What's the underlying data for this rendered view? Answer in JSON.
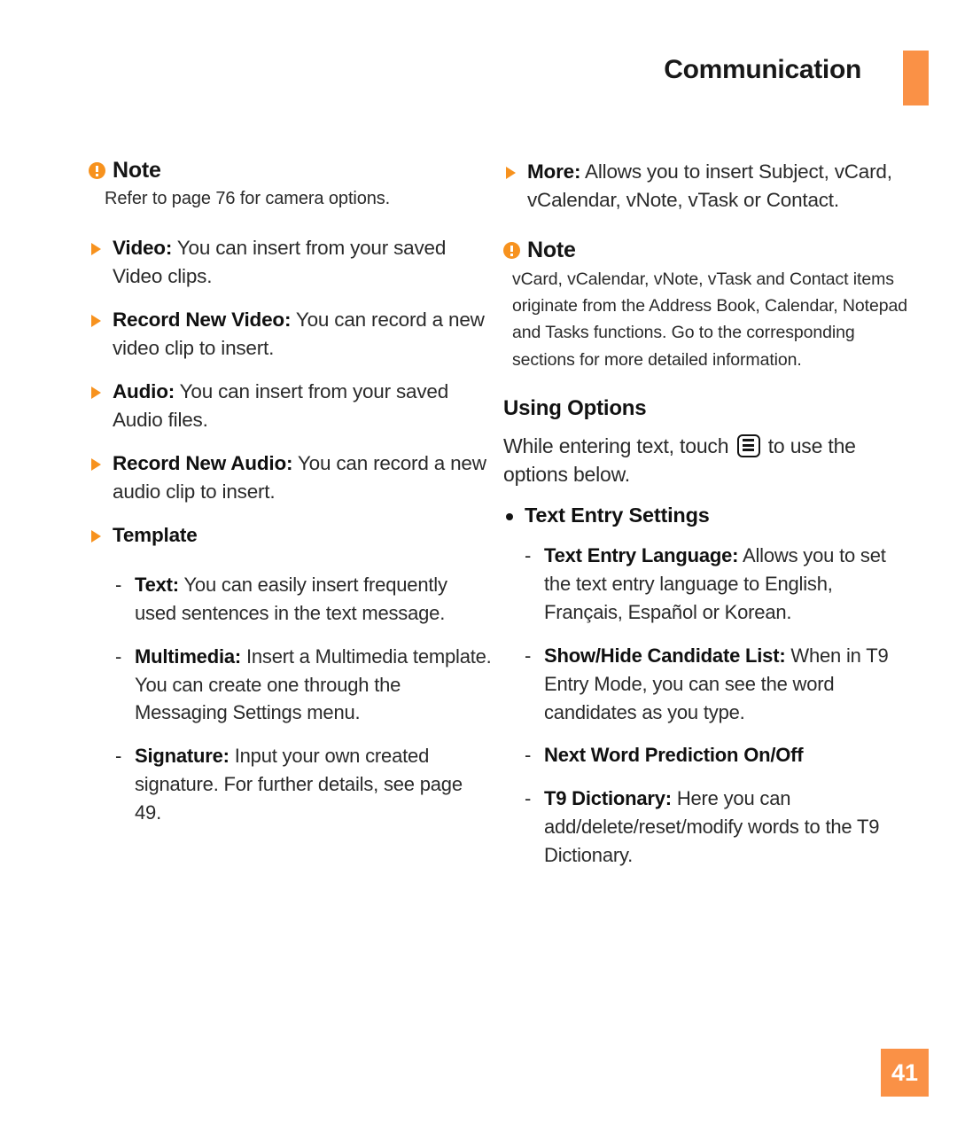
{
  "header": {
    "title": "Communication",
    "tab_color": "#fa9146"
  },
  "accent_color": "#f7921e",
  "page_number": "41",
  "left_column": {
    "note1": {
      "heading": "Note",
      "body": "Refer to page 76 for camera options."
    },
    "items": [
      {
        "term": "Video:",
        "text": " You can insert from your saved Video clips."
      },
      {
        "term": "Record New Video:",
        "text": " You can record a new video clip to insert."
      },
      {
        "term": "Audio:",
        "text": " You can insert from your saved Audio files."
      },
      {
        "term": "Record New Audio:",
        "text": " You can record a new audio clip to insert."
      },
      {
        "term": "Template",
        "text": ""
      }
    ],
    "sub_items": [
      {
        "dash": "-",
        "term": "Text:",
        "text": " You can easily insert frequently used sentences in the text message."
      },
      {
        "dash": "-",
        "term": "Multimedia:",
        "text": " Insert a Multimedia template. You can create one through the Messaging Settings menu."
      },
      {
        "dash": "-",
        "term": "Signature:",
        "text": " Input your own created signature. For further details, see page 49."
      }
    ]
  },
  "right_column": {
    "more_item": {
      "term": "More:",
      "text": " Allows you to insert Subject, vCard, vCalendar, vNote, vTask or Contact."
    },
    "note2": {
      "heading": "Note",
      "body": "vCard, vCalendar, vNote, vTask and Contact items originate from the Address Book, Calendar, Notepad and Tasks functions. Go to the corresponding sections for more detailed information."
    },
    "section": {
      "heading": "Using Options",
      "para_before_icon": "While entering text, touch",
      "para_after_icon": "to use the options below."
    },
    "bullet": {
      "label": "Text Entry Settings"
    },
    "sub_items": [
      {
        "dash": "-",
        "term": "Text Entry Language:",
        "text": " Allows you to set the text entry language to English, Français, Español or Korean."
      },
      {
        "dash": "-",
        "term": "Show/Hide Candidate List:",
        "text": " When in T9 Entry Mode, you can see the word candidates as you type."
      },
      {
        "dash": "-",
        "term": "Next Word Prediction On/Off",
        "text": ""
      },
      {
        "dash": "-",
        "term": "T9 Dictionary:",
        "text": " Here you can add/delete/reset/modify words to the T9 Dictionary."
      }
    ]
  }
}
